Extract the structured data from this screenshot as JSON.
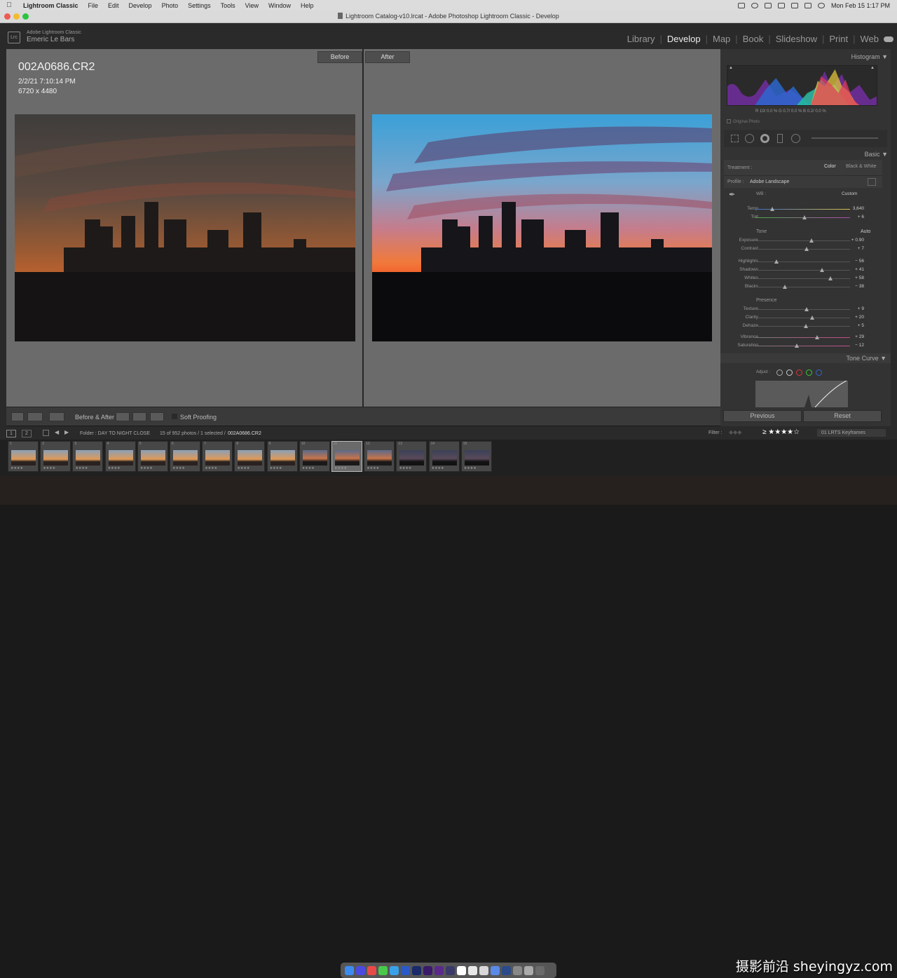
{
  "menubar": {
    "app": "Lightroom Classic",
    "items": [
      "File",
      "Edit",
      "Develop",
      "Photo",
      "Settings",
      "Tools",
      "View",
      "Window",
      "Help"
    ],
    "clock": "Mon Feb 15  1:17 PM"
  },
  "window": {
    "title": "Lightroom Catalog-v10.lrcat - Adobe Photoshop Lightroom Classic - Develop"
  },
  "identity": {
    "logo": "Lrc",
    "product": "Adobe Lightroom Classic",
    "user": "Emeric Le Bars"
  },
  "modules": [
    "Library",
    "Develop",
    "Map",
    "Book",
    "Slideshow",
    "Print",
    "Web"
  ],
  "active_module": "Develop",
  "view": {
    "before_label": "Before",
    "after_label": "After",
    "filename": "002A0686.CR2",
    "datetime": "2/2/21 7:10:14 PM",
    "dimensions": "6720 x 4480"
  },
  "toolbar": {
    "before_after": "Before & After :",
    "soft_proofing": "Soft Proofing"
  },
  "histogram": {
    "title": "Histogram",
    "readout": "R  10/  0.0 %    G  0.7/  0.0 %    B  0.2/  0.0 %",
    "original_photo": "Original Photo"
  },
  "basic": {
    "title": "Basic",
    "treatment_label": "Treatment :",
    "treatment_color": "Color",
    "treatment_bw": "Black & White",
    "profile_label": "Profile :",
    "profile_value": "Adobe Landscape",
    "wb_label": "WB :",
    "wb_value": "Custom",
    "tone_label": "Tone",
    "auto_label": "Auto",
    "presence_label": "Presence",
    "sliders": [
      {
        "label": "Temp",
        "value": "3,640",
        "level": 0.18
      },
      {
        "label": "Tint",
        "value": "+ 6",
        "level": 0.52
      },
      {
        "label": "Exposure",
        "value": "+ 0.90",
        "level": 0.59
      },
      {
        "label": "Contrast",
        "value": "+ 7",
        "level": 0.54
      },
      {
        "label": "Highlights",
        "value": "− 56",
        "level": 0.22
      },
      {
        "label": "Shadows",
        "value": "+ 41",
        "level": 0.7
      },
      {
        "label": "Whites",
        "value": "+ 58",
        "level": 0.79
      },
      {
        "label": "Blacks",
        "value": "− 38",
        "level": 0.31
      },
      {
        "label": "Texture",
        "value": "+ 9",
        "level": 0.54
      },
      {
        "label": "Clarity",
        "value": "+ 20",
        "level": 0.6
      },
      {
        "label": "Dehaze",
        "value": "+ 5",
        "level": 0.53
      },
      {
        "label": "Vibrance",
        "value": "+ 29",
        "level": 0.65
      },
      {
        "label": "Saturation",
        "value": "− 12",
        "level": 0.44
      }
    ]
  },
  "tone_curve": {
    "title": "Tone Curve",
    "adjust_label": "Adjust :"
  },
  "buttons": {
    "previous": "Previous",
    "reset": "Reset"
  },
  "filmstrip_bar": {
    "folder": "Folder : DAY TO NIGHT CLOSE",
    "count": "15 of 952 photos / 1 selected /",
    "selected_file": "002A0686.CR2",
    "filter_label": "Filter :",
    "filter_preset": "01 LRTS Keyframes",
    "page1": "1",
    "page2": "2"
  },
  "filmstrip": {
    "thumbs": [
      {
        "num": "1",
        "stars": "★★★★",
        "sel": false
      },
      {
        "num": "2",
        "stars": "★★★★",
        "sel": false
      },
      {
        "num": "3",
        "stars": "★★★★",
        "sel": false
      },
      {
        "num": "4",
        "stars": "★★★★",
        "sel": false
      },
      {
        "num": "5",
        "stars": "★★★★",
        "sel": false
      },
      {
        "num": "6",
        "stars": "★★★★",
        "sel": false
      },
      {
        "num": "7",
        "stars": "★★★★",
        "sel": false
      },
      {
        "num": "8",
        "stars": "★★★★",
        "sel": false
      },
      {
        "num": "9",
        "stars": "★★★★",
        "sel": false
      },
      {
        "num": "10",
        "stars": "★★★★",
        "sel": false
      },
      {
        "num": "11",
        "stars": "★★★★",
        "sel": true
      },
      {
        "num": "12",
        "stars": "★★★★",
        "sel": false
      },
      {
        "num": "13",
        "stars": "★★★★",
        "sel": false
      },
      {
        "num": "14",
        "stars": "★★★★",
        "sel": false
      },
      {
        "num": "15",
        "stars": "★★★★",
        "sel": false
      }
    ]
  },
  "watermark": "摄影前沿 sheyingyz.com",
  "colors": {
    "accent": "#f0a13a",
    "panel": "#333333",
    "canvas": "#6b6b6b"
  }
}
